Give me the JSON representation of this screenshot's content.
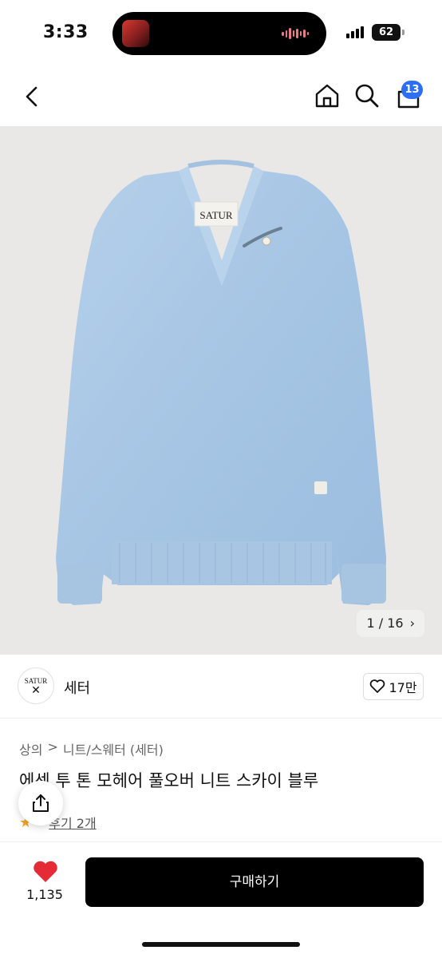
{
  "status": {
    "time": "3:33",
    "battery": "62"
  },
  "header": {
    "cart_count": "13"
  },
  "product_image": {
    "counter_current": "1 / 16",
    "counter_next": "›",
    "label_text": "SATUR"
  },
  "brand": {
    "logo_text_top": "SATUR",
    "name": "세터",
    "like_count": "17만"
  },
  "breadcrumb": {
    "items": [
      "상의",
      "니트/스웨터 (세터)"
    ],
    "separator": ">"
  },
  "product": {
    "title": "에센 투 톤 모헤어 풀오버 니트 스카이 블루",
    "rating_suffix": "·",
    "review_link": "후기 2개"
  },
  "bottom_bar": {
    "like_total": "1,135",
    "buy_label": "구매하기"
  },
  "colors": {
    "accent_blue": "#2c6ff2",
    "sweater": "#a9c8e6",
    "heart_red": "#e52b36",
    "star": "#f5a623"
  },
  "icons": [
    "back-chevron-icon",
    "home-icon",
    "search-icon",
    "cart-icon",
    "heart-outline-icon",
    "share-icon",
    "heart-filled-icon",
    "star-icon"
  ]
}
